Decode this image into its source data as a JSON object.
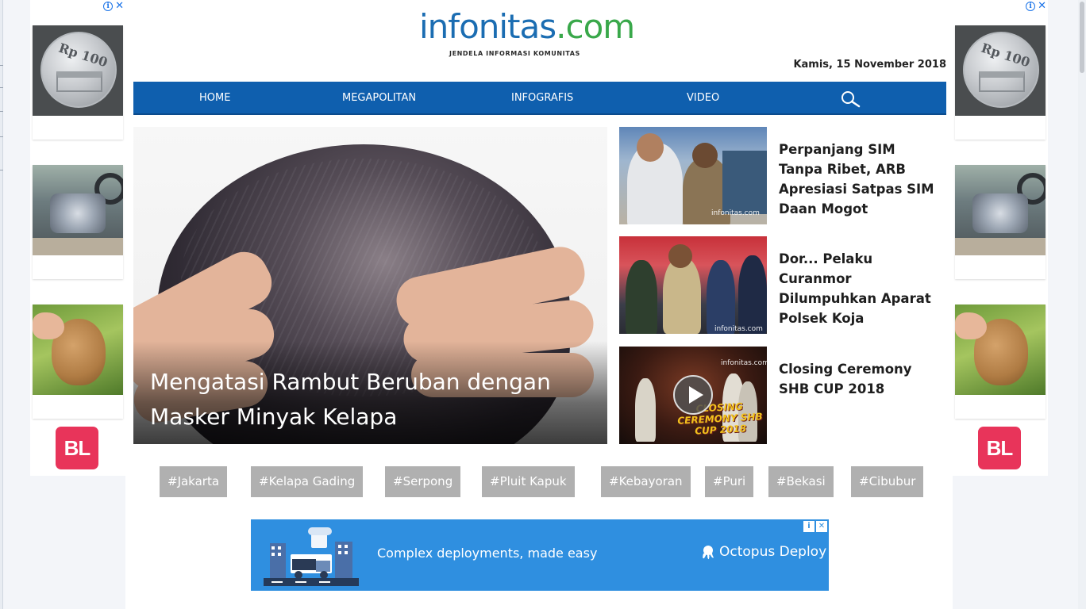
{
  "site": {
    "logo_main": "infonitas",
    "logo_domain": ".com",
    "tagline": "JENDELA INFORMASI KOMUNITAS",
    "date": "Kamis, 15 November 2018"
  },
  "nav": {
    "items": [
      {
        "label": "HOME"
      },
      {
        "label": "MEGAPOLITAN"
      },
      {
        "label": "INFOGRAFIS"
      },
      {
        "label": "VIDEO"
      }
    ],
    "search_icon": "search-icon"
  },
  "hero": {
    "title": "Mengatasi Rambut Beruban dengan Masker Minyak Kelapa"
  },
  "side_news": [
    {
      "title": "Perpanjang SIM Tanpa Ribet, ARB Apresiasi Satpas SIM Daan Mogot",
      "watermark": "infonitas.com"
    },
    {
      "title": "Dor... Pelaku Curanmor Dilumpuhkan Aparat Polsek Koja",
      "watermark": "infonitas.com"
    },
    {
      "title": "Closing Ceremony SHB CUP 2018",
      "watermark": "infonitas.com",
      "overlay": "CLOSING CEREMONY SHB CUP 2018",
      "play_icon": "play-icon"
    }
  ],
  "tags": [
    "#Jakarta",
    "#Kelapa Gading",
    "#Serpong",
    "#Pluit Kapuk",
    "#Kebayoran",
    "#Puri",
    "#Bekasi",
    "#Cibubur"
  ],
  "side_ads": {
    "coin_text": "Rp 100",
    "bl_logo": "BL",
    "adchoices_icon": "adchoices-icon",
    "close_icon": "close-icon"
  },
  "bottom_ad": {
    "text": "Complex deployments, made easy",
    "brand": "Octopus Deploy"
  },
  "colors": {
    "nav_bg": "#0f5fae",
    "logo_blue": "#1b6db2",
    "logo_green": "#39a84a",
    "tag_bg": "#b0b0b0",
    "ad_blue": "#2f8fe0",
    "bl_red": "#e8345a"
  }
}
